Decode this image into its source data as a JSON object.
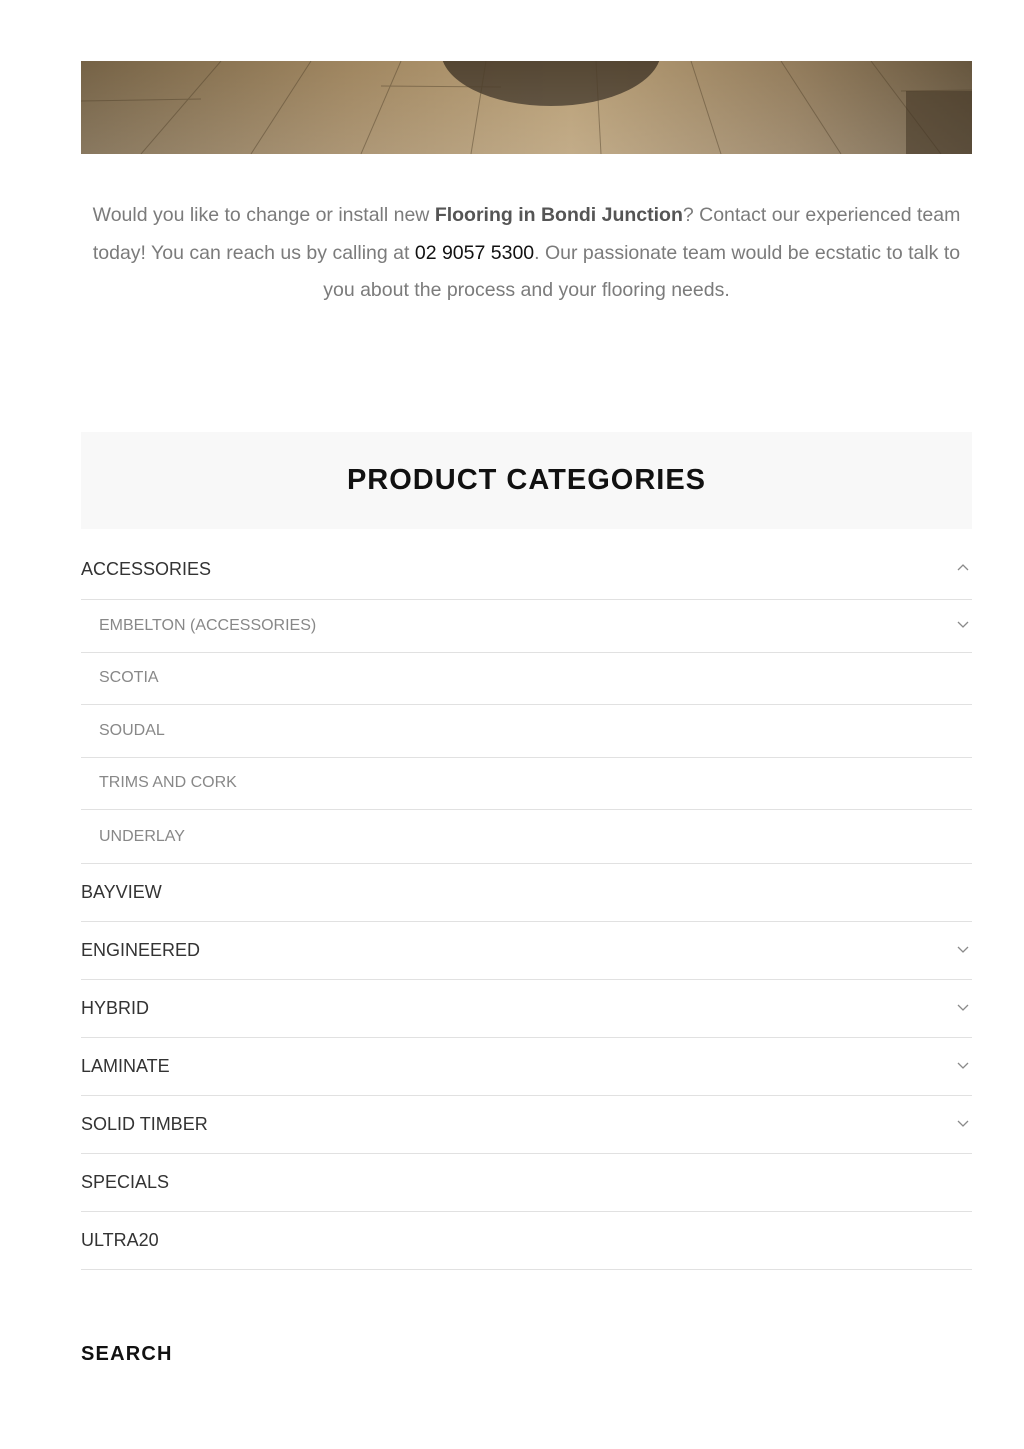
{
  "intro": {
    "text_before": "Would you like to change or install new ",
    "strong_text": "Flooring in Bondi Junction",
    "text_middle": "? Contact our experienced team today! You can reach us by calling at ",
    "phone": "02 9057 5300",
    "text_after": ". Our passionate team would be ecstatic to talk to you about the process and your flooring needs."
  },
  "product_categories": {
    "title": "PRODUCT CATEGORIES",
    "items": [
      {
        "label": "ACCESSORIES",
        "level": "top",
        "expanded": true,
        "has_children": true,
        "chevron": "chevron-up-icon"
      },
      {
        "label": "EMBELTON (ACCESSORIES)",
        "level": "sub",
        "has_children": true,
        "chevron": "chevron-down-icon"
      },
      {
        "label": "SCOTIA",
        "level": "sub",
        "has_children": false
      },
      {
        "label": "SOUDAL",
        "level": "sub",
        "has_children": false
      },
      {
        "label": "TRIMS AND CORK",
        "level": "sub",
        "has_children": false
      },
      {
        "label": "UNDERLAY",
        "level": "sub",
        "has_children": false
      },
      {
        "label": "BAYVIEW",
        "level": "top",
        "has_children": false
      },
      {
        "label": "ENGINEERED",
        "level": "top",
        "has_children": true,
        "chevron": "chevron-down-icon"
      },
      {
        "label": "HYBRID",
        "level": "top",
        "has_children": true,
        "chevron": "chevron-down-icon"
      },
      {
        "label": "LAMINATE",
        "level": "top",
        "has_children": true,
        "chevron": "chevron-down-icon"
      },
      {
        "label": "SOLID TIMBER",
        "level": "top",
        "has_children": true,
        "chevron": "chevron-down-icon"
      },
      {
        "label": "SPECIALS",
        "level": "top",
        "has_children": false
      },
      {
        "label": "ULTRA20",
        "level": "top",
        "has_children": false
      }
    ]
  },
  "search": {
    "title": "SEARCH"
  },
  "colors": {
    "heading": "#111111",
    "body_text": "#7b7b7b",
    "sub_item_text": "#888888",
    "divider": "#e1e1e1",
    "panel_background": "#f8f8f8"
  }
}
